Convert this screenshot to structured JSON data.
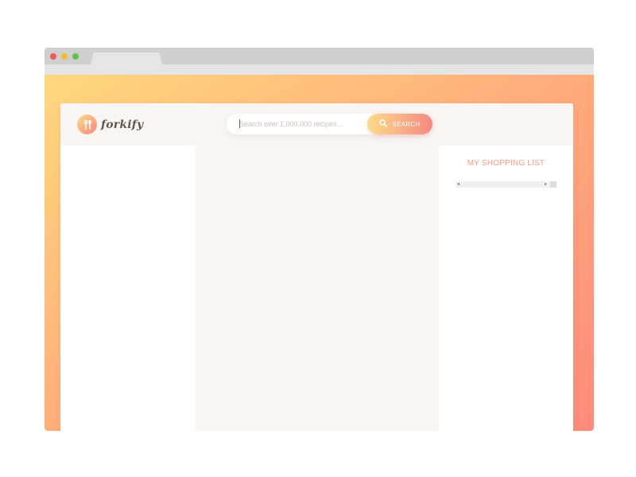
{
  "app": {
    "logo_text": "forkify",
    "logo_icon": "fork-spoon-icon"
  },
  "search": {
    "placeholder": "Search over 1,000,000 recipes...",
    "value": "",
    "button_label": "SEARCH",
    "button_icon": "search-icon"
  },
  "shopping": {
    "title": "MY SHOPPING LIST",
    "scroll_left": "◂",
    "scroll_right": "▸"
  },
  "colors": {
    "accent": "#f48982",
    "accent_light": "#fbdb89",
    "header_bg": "#f9f5f3",
    "logo_text": "#615551"
  }
}
